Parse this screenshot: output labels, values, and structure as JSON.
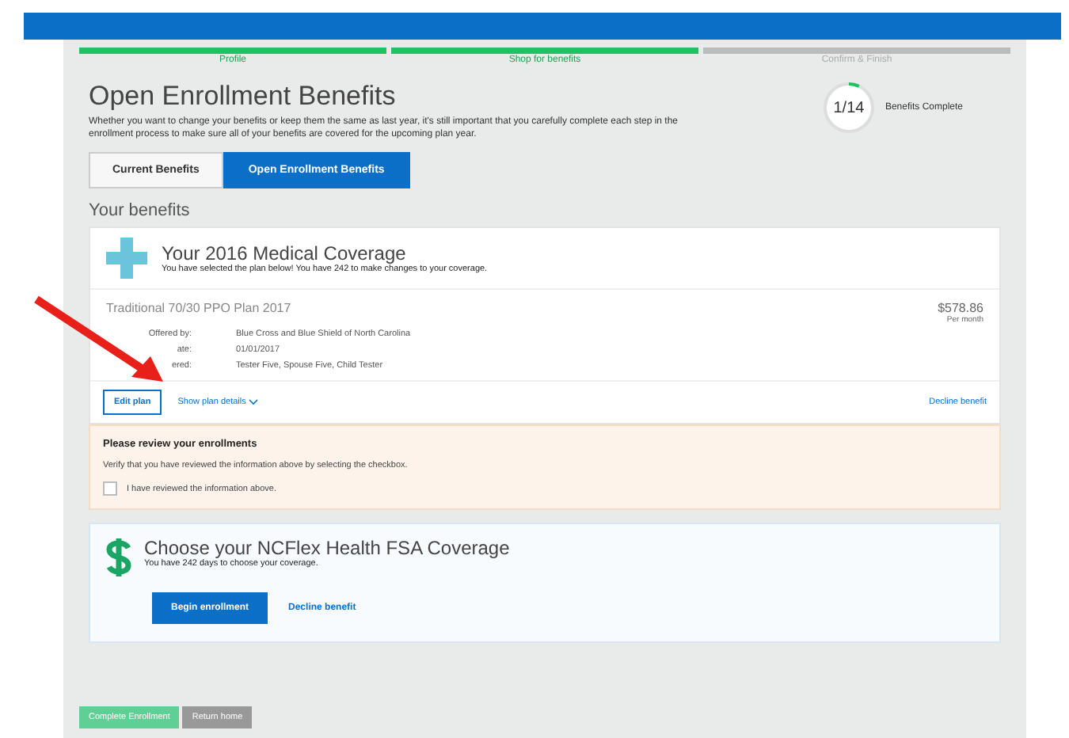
{
  "steps": [
    {
      "label": "Profile",
      "done": true
    },
    {
      "label": "Shop for benefits",
      "done": true
    },
    {
      "label": "Confirm & Finish",
      "done": false
    }
  ],
  "title": "Open Enrollment Benefits",
  "intro": "Whether you want to change your benefits or keep them the same as last year, it's still important that you carefully complete each step in the enrollment process to make sure all of your benefits are covered for the upcoming plan year.",
  "progress": {
    "count": "1/14",
    "label": "Benefits Complete",
    "level": 0.07
  },
  "tabs": [
    {
      "label": "Current Benefits",
      "selected": false
    },
    {
      "label": "Open Enrollment Benefits",
      "selected": true
    }
  ],
  "section_title": "Your benefits",
  "medical": {
    "title": "Your 2016 Medical Coverage",
    "subtitle": "You have selected the plan below! You have 242 to make changes to your coverage.",
    "plan": "Traditional 70/30 PPO Plan 2017",
    "price": "$578.86",
    "price_note": "Per month",
    "details": [
      {
        "label": "Offered by:",
        "value": "Blue Cross and Blue Shield of North Carolina"
      },
      {
        "label": "ate:",
        "value": "01/01/2017"
      },
      {
        "label": "ered:",
        "value": "Tester Five, Spouse Five, Child Tester"
      }
    ],
    "edit": "Edit plan",
    "show_details": "Show plan details",
    "decline": "Decline benefit"
  },
  "review": {
    "title": "Please review your enrollments",
    "text": "Verify that you have reviewed the information above by selecting the checkbox.",
    "checkbox_label": "I have reviewed the information above.",
    "checked": false
  },
  "fsa": {
    "title": "Choose your NCFlex Health FSA Coverage",
    "subtitle": "You have 242 days to choose your coverage.",
    "begin": "Begin enrollment",
    "decline": "Decline benefit"
  },
  "footer_buttons": [
    {
      "label": "Complete Enrollment",
      "kind": "primary"
    },
    {
      "label": "Return home",
      "kind": "secondary"
    }
  ]
}
